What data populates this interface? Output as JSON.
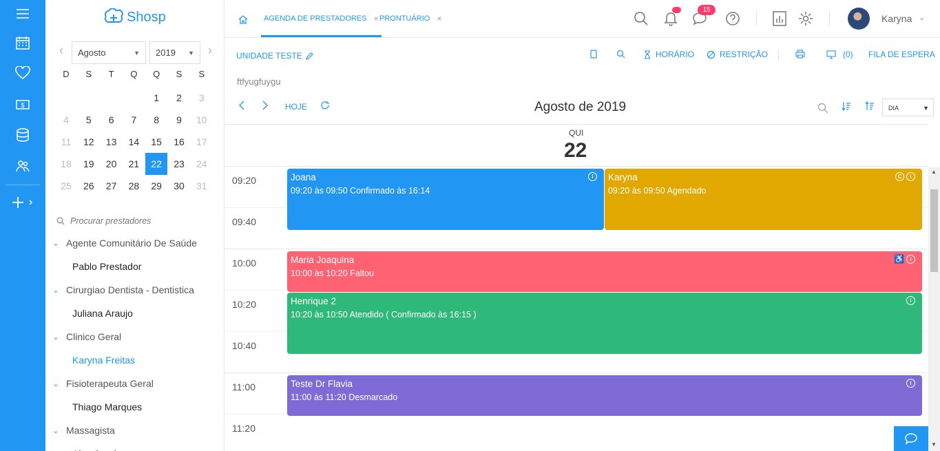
{
  "app": {
    "logo_text": "Shosp"
  },
  "calendar": {
    "month": "Agosto",
    "year": "2019",
    "weekdays": [
      "D",
      "S",
      "T",
      "Q",
      "Q",
      "S",
      "S"
    ],
    "weeks": [
      [
        "",
        "",
        "",
        "",
        "1",
        "2",
        "3"
      ],
      [
        "4",
        "5",
        "6",
        "7",
        "8",
        "9",
        "10"
      ],
      [
        "11",
        "12",
        "13",
        "14",
        "15",
        "16",
        "17"
      ],
      [
        "18",
        "19",
        "20",
        "21",
        "22",
        "23",
        "24"
      ],
      [
        "25",
        "26",
        "27",
        "28",
        "29",
        "30",
        "31"
      ]
    ],
    "selected_day": "22"
  },
  "sidebar": {
    "search_placeholder": "Procurar prestadores",
    "groups": [
      {
        "name": "Agente Comunitário De Saúde",
        "providers": [
          "Pablo Prestador"
        ]
      },
      {
        "name": "Cirurgiao Dentista - Dentistica",
        "providers": [
          "Juliana Araujo"
        ]
      },
      {
        "name": "Clinico Geral",
        "providers": [
          "Karyna Freitas"
        ]
      },
      {
        "name": "Fisioterapeuta Geral",
        "providers": [
          "Thiago Marques"
        ]
      },
      {
        "name": "Massagista",
        "providers": [
          "Alex Sandro"
        ]
      }
    ],
    "active_provider": "Karyna Freitas"
  },
  "tabs": [
    {
      "label": "AGENDA DE PRESTADORES",
      "active": true
    },
    {
      "label": "PRONTUÁRIO",
      "active": false
    }
  ],
  "header": {
    "chat_badge": "15",
    "user_name": "Karyna"
  },
  "toolbar": {
    "unit": "UNIDADE TESTE",
    "horario": "HORÁRIO",
    "restricao": "RESTRIÇÃO",
    "waiting_count": "(0)",
    "waiting_label": "FILA DE ESPERA",
    "subtitle": "ftfyugfuygu",
    "today": "HOJE",
    "month_title": "Agosto de 2019",
    "view": "DIA"
  },
  "day": {
    "dow": "QUI",
    "num": "22"
  },
  "times": [
    "09:20",
    "09:40",
    "10:00",
    "10:20",
    "10:40",
    "11:00",
    "11:20"
  ],
  "events": [
    {
      "name": "Joana",
      "detail": "09:20 às 09:50 Confirmado às 16:14",
      "color": "#2196f3"
    },
    {
      "name": "Karyna",
      "detail": "09:20 às 09:50 Agendado",
      "color": "#e0a800"
    },
    {
      "name": "Maria Joaquina",
      "detail": "10:00 às 10:20 Faltou",
      "color": "#ff6272"
    },
    {
      "name": "Henrique 2",
      "detail": "10:20 às 10:50 Atendido ( Confirmado às 16:15 )",
      "color": "#2eb87a"
    },
    {
      "name": "Teste Dr Flavia",
      "detail": "11:00 às 11:20 Desmarcado",
      "color": "#7e6bd6"
    }
  ]
}
